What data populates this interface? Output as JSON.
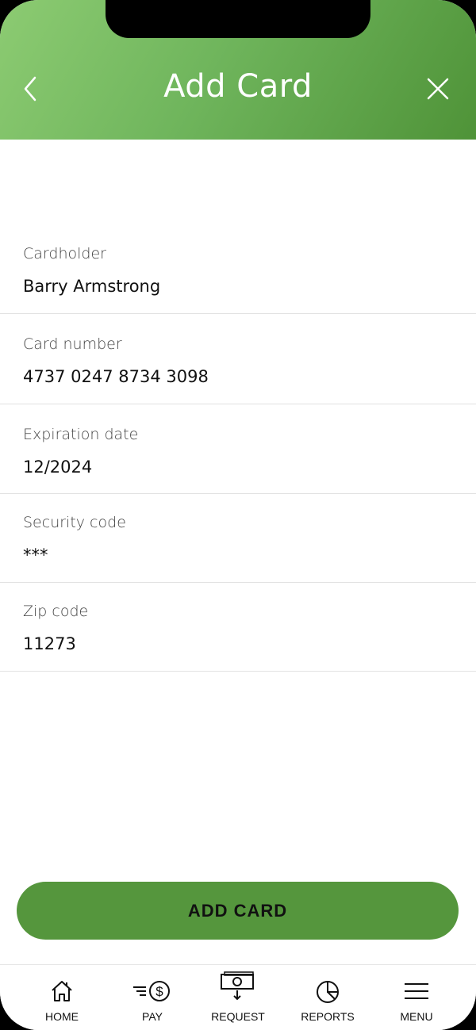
{
  "header": {
    "title": "Add Card"
  },
  "form": {
    "cardholder": {
      "label": "Cardholder",
      "value": "Barry Armstrong"
    },
    "card_number": {
      "label": "Card number",
      "value": "4737 0247 8734 3098"
    },
    "expiration": {
      "label": "Expiration date",
      "value": "12/2024"
    },
    "security": {
      "label": "Security code",
      "value": "***"
    },
    "zip": {
      "label": "Zip code",
      "value": "11273"
    }
  },
  "submit_label": "ADD CARD",
  "tabs": [
    {
      "label": "HOME",
      "icon": "home-icon"
    },
    {
      "label": "PAY",
      "icon": "pay-icon"
    },
    {
      "label": "REQUEST",
      "icon": "request-icon"
    },
    {
      "label": "REPORTS",
      "icon": "reports-icon"
    },
    {
      "label": "MENU",
      "icon": "menu-icon"
    }
  ],
  "colors": {
    "header_start": "#8ccb72",
    "header_end": "#4f9338",
    "button": "#55963d"
  }
}
